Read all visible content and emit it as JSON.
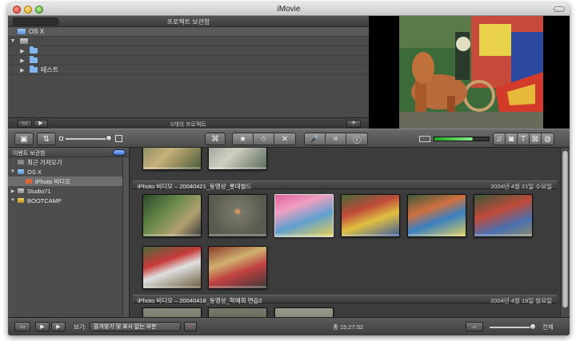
{
  "window": {
    "title": "iMovie"
  },
  "project_library": {
    "header_title": "프로젝트 보관함",
    "items": [
      {
        "label": "OS X",
        "icon": "drive-icon",
        "indent": 0,
        "selected": true,
        "triangle": ""
      },
      {
        "label": "",
        "icon": "drive-icon",
        "indent": 0,
        "selected": false,
        "triangle": "▼"
      },
      {
        "label": "",
        "icon": "folder-icon",
        "indent": 1,
        "selected": false,
        "triangle": "▶"
      },
      {
        "label": "",
        "icon": "folder-icon",
        "indent": 1,
        "selected": false,
        "triangle": "▶"
      },
      {
        "label": "테스트",
        "icon": "folder-icon",
        "indent": 1,
        "selected": false,
        "triangle": "▶"
      }
    ],
    "footer_count": "0개의 프로젝트",
    "add_label": "+"
  },
  "event_library": {
    "header_title": "이벤트 보관함",
    "items": [
      {
        "label": "최근 가져오기",
        "icon": "film-icon",
        "triangle": "",
        "indent": 0,
        "selected": false
      },
      {
        "label": "OS X",
        "icon": "drive-icon",
        "triangle": "▼",
        "indent": 0,
        "selected": false
      },
      {
        "label": "iPhoto 비디오",
        "icon": "iphoto-icon",
        "triangle": "",
        "indent": 1,
        "selected": true
      },
      {
        "label": "Studio71",
        "icon": "drive-icon",
        "triangle": "▶",
        "indent": 0,
        "selected": false
      },
      {
        "label": "BOOTCAMP",
        "icon": "drive-icon",
        "triangle": "▼",
        "indent": 0,
        "selected": false
      }
    ]
  },
  "events": [
    {
      "title": "iPhoto 비디오 – 20040421_동영상_롯데월드",
      "date": "2004년 4월 21일 수요일"
    },
    {
      "title": "iPhoto 비디오 – 20040418_동영상_학예회 연습2",
      "date": "2004년 4월 19일 월요일"
    }
  ],
  "bottom_bar": {
    "view_label": "보기:",
    "view_option": "즐겨찾기 및 표시 없는 부분",
    "total": "총 15:27:52",
    "all_label": "전체"
  },
  "colors": {
    "accent_blue": "#7fb6ee",
    "meter_green": "#88ee88"
  }
}
